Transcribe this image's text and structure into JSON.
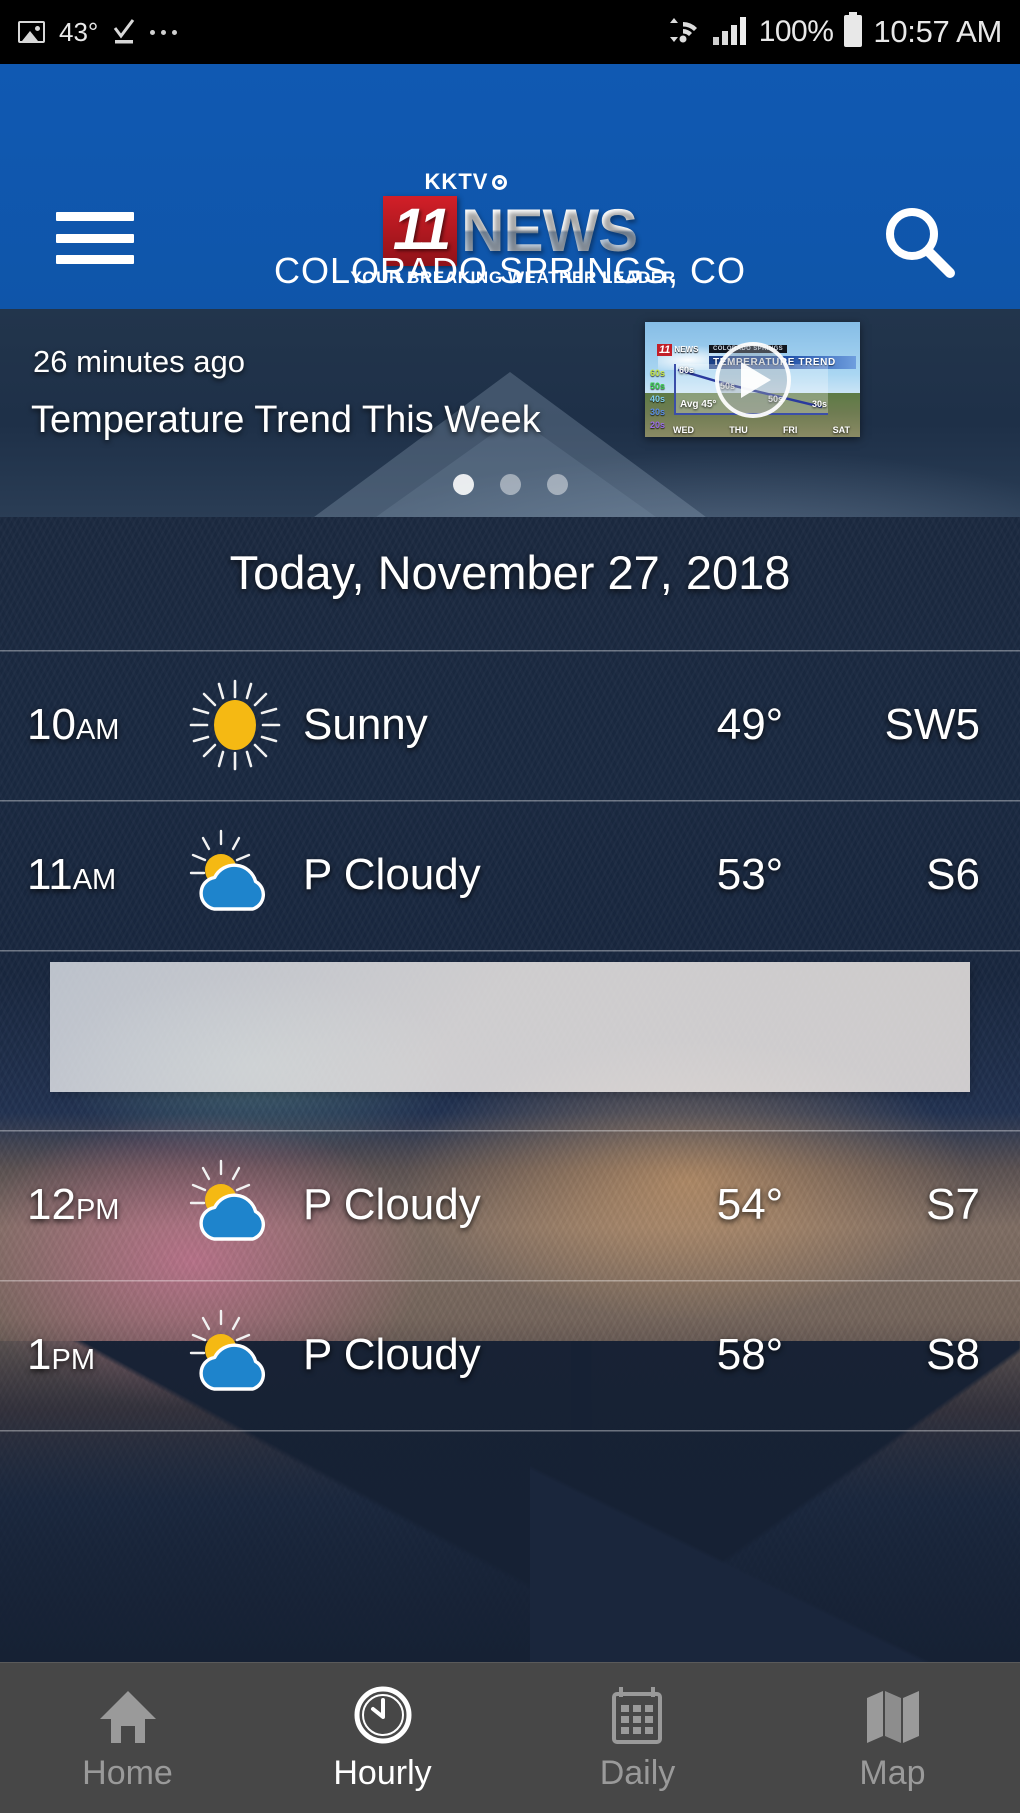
{
  "status_bar": {
    "temperature": "43°",
    "battery_percent": "100%",
    "time": "10:57 AM",
    "icons": [
      "photo-icon",
      "download-complete-icon",
      "more-dots-icon",
      "wifi-icon",
      "cellular-signal-icon",
      "battery-icon"
    ]
  },
  "header": {
    "menu_icon": "hamburger-menu-icon",
    "search_icon": "search-icon",
    "logo": {
      "callsign": "KKTV",
      "network_icon": "cbs-eye-icon",
      "channel": "11",
      "word": "NEWS",
      "tagline": "YOUR BREAKING WEATHER LEADER"
    },
    "location": "COLORADO SPRINGS, CO",
    "background_color": "#1158b0"
  },
  "carousel": {
    "timestamp": "26 minutes ago",
    "title": "Temperature Trend This Week",
    "play_icon": "play-button-icon",
    "thumbnail": {
      "station_badge": "11",
      "station_word": "NEWS",
      "banner_top": "COLORADO SPRINGS",
      "banner_main": "TEMPERATURE TREND",
      "y_axis": [
        "60s",
        "50s",
        "40s",
        "30s",
        "20s"
      ],
      "point_labels": [
        "60s",
        "50s",
        "50s",
        "30s"
      ],
      "average": "Avg 45°",
      "days": [
        "WED",
        "THU",
        "FRI",
        "SAT"
      ]
    },
    "dots": [
      {
        "active": true
      },
      {
        "active": false
      },
      {
        "active": false
      }
    ]
  },
  "forecast": {
    "date_header": "Today, November 27, 2018",
    "rows": [
      {
        "time": "10",
        "meridiem": "AM",
        "icon": "sunny-icon",
        "condition": "Sunny",
        "temperature": "49°",
        "wind": "SW5"
      },
      {
        "time": "11",
        "meridiem": "AM",
        "icon": "partly-cloudy-icon",
        "condition": "P Cloudy",
        "temperature": "53°",
        "wind": "S6"
      },
      {
        "time": "12",
        "meridiem": "PM",
        "icon": "partly-cloudy-icon",
        "condition": "P Cloudy",
        "temperature": "54°",
        "wind": "S7"
      },
      {
        "time": "1",
        "meridiem": "PM",
        "icon": "partly-cloudy-icon",
        "condition": "P Cloudy",
        "temperature": "58°",
        "wind": "S8"
      }
    ]
  },
  "bottom_nav": {
    "items": [
      {
        "label": "Home",
        "icon": "home-icon",
        "active": false
      },
      {
        "label": "Hourly",
        "icon": "clock-icon",
        "active": true
      },
      {
        "label": "Daily",
        "icon": "calendar-icon",
        "active": false
      },
      {
        "label": "Map",
        "icon": "map-icon",
        "active": false
      }
    ]
  },
  "colors": {
    "brand_blue": "#1158b0",
    "badge_red": "#c21f28",
    "sun_yellow": "#f5b913",
    "cloud_blue": "#1e84cc",
    "nav_bg": "#474747"
  }
}
